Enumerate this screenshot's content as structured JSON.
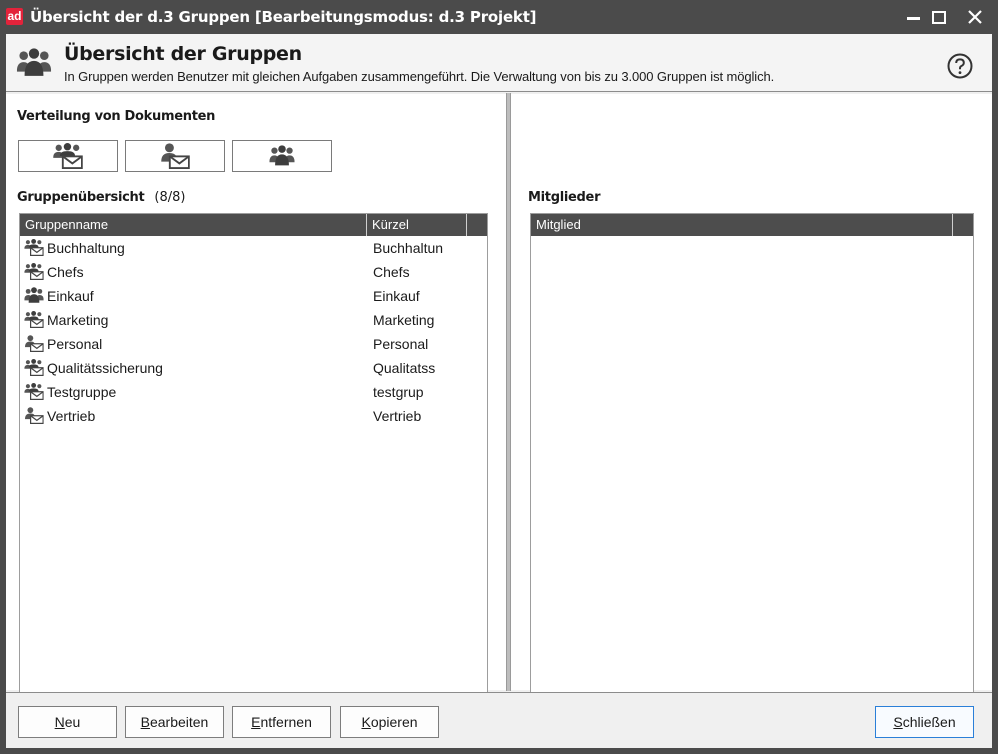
{
  "window": {
    "logo_text": "ad",
    "title": "Übersicht der d.3 Gruppen [Bearbeitungsmodus: d.3 Projekt]"
  },
  "header": {
    "title": "Übersicht der Gruppen",
    "description": "In Gruppen werden Benutzer mit gleichen Aufgaben zusammengeführt. Die Verwaltung von bis zu 3.000 Gruppen ist möglich."
  },
  "distribution": {
    "label": "Verteilung von Dokumenten",
    "buttons": [
      {
        "icon": "group-mail-icon"
      },
      {
        "icon": "user-mail-icon"
      },
      {
        "icon": "group-icon"
      }
    ]
  },
  "groups": {
    "label": "Gruppenübersicht",
    "count": "(8/8)",
    "columns": [
      "Gruppenname",
      "Kürzel"
    ],
    "rows": [
      {
        "icon": "group-mail-icon",
        "name": "Buchhaltung",
        "short": "Buchhaltun"
      },
      {
        "icon": "group-mail-icon",
        "name": "Chefs",
        "short": "Chefs"
      },
      {
        "icon": "group-icon",
        "name": "Einkauf",
        "short": "Einkauf"
      },
      {
        "icon": "group-mail-icon",
        "name": "Marketing",
        "short": "Marketing"
      },
      {
        "icon": "user-mail-icon",
        "name": "Personal",
        "short": "Personal"
      },
      {
        "icon": "group-mail-icon",
        "name": "Qualitätssicherung",
        "short": "Qualitatss"
      },
      {
        "icon": "group-mail-icon",
        "name": "Testgruppe",
        "short": "testgrup"
      },
      {
        "icon": "user-mail-icon",
        "name": "Vertrieb",
        "short": "Vertrieb"
      }
    ]
  },
  "members": {
    "label": "Mitglieder",
    "columns": [
      "Mitglied"
    ]
  },
  "footer": {
    "buttons": [
      {
        "accel": "N",
        "rest": "eu"
      },
      {
        "accel": "B",
        "rest": "earbeiten"
      },
      {
        "accel": "E",
        "rest": "ntfernen"
      },
      {
        "accel": "K",
        "rest": "opieren"
      }
    ],
    "close": {
      "accel": "S",
      "rest": "chließen"
    }
  },
  "colors": {
    "titlebar": "#4b4b4b",
    "accent": "#e3233b",
    "list_header": "#4d4d4d",
    "primary_border": "#2a7fd8"
  }
}
